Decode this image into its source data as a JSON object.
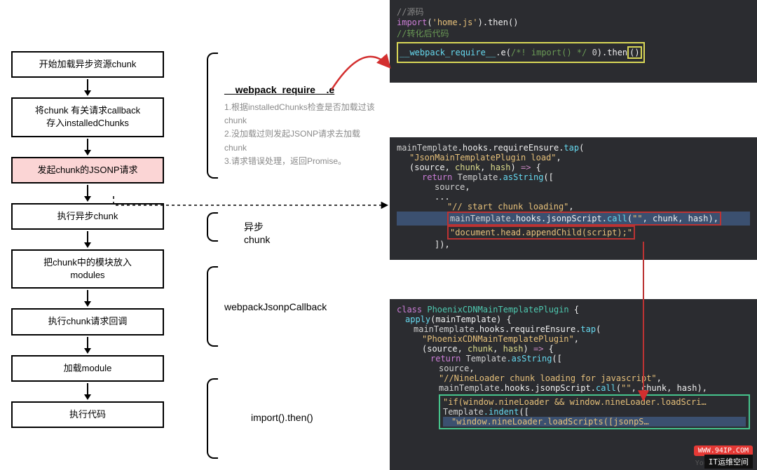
{
  "flowchart": {
    "steps": [
      "开始加载异步资源chunk",
      "将chunk 有关请求callback\n存入installedChunks",
      "发起chunk的JSONP请求",
      "执行异步chunk",
      "把chunk中的模块放入\nmodules",
      "执行chunk请求回调",
      "加载module",
      "执行代码"
    ]
  },
  "braces": {
    "b1": {
      "title": "__webpack_require__.e",
      "desc1": "1.根据installedChunks检查是否加载过该chunk",
      "desc2": "2.没加载过则发起JSONP请求去加载chunk",
      "desc3": "3.请求错误处理，返回Promise。"
    },
    "b2": {
      "title": "异步 chunk"
    },
    "b3": {
      "title": "webpackJsonpCallback"
    },
    "b4": {
      "title": "import().then()"
    }
  },
  "code1": {
    "l1_cm": "//源码",
    "l2_kw": "import",
    "l2_p": "(",
    "l2_str": "'home.js'",
    "l2_p2": ").then()",
    "l3_cm": "//转化后代码",
    "l4_a": "__webpack_require__",
    "l4_b": ".e(",
    "l4_cm": "/*! import() */",
    "l4_c": " 0",
    "l4_d": ").then",
    "l4_e": "()"
  },
  "code2": {
    "l1_a": "mainTemplate",
    "l1_b": ".hooks.requireEnsure.",
    "l1_c": "tap",
    "l1_d": "(",
    "l2_a": "\"JsonMainTemplatePlugin load\"",
    "l2_b": ",",
    "l3_a": "(source",
    "l3_b": ", ",
    "l3_c": "chunk",
    "l3_d": ", ",
    "l3_e": "hash",
    "l3_f": ") ",
    "l3_ar": "=>",
    "l3_g": " {",
    "l4_a": "return",
    "l4_b": " Template",
    "l4_c": ".asString",
    "l4_d": "([",
    "l5_a": "source",
    "l5_b": ",",
    "l6_a": "...",
    "l6_b": "",
    "l7_a": "\"// start chunk loading\"",
    "l7_b": ",",
    "l8_a": "mainTemplate",
    "l8_b": ".hooks.jsonpScript.",
    "l8_c": "call",
    "l8_d": "(",
    "l8_e": "\"\"",
    "l8_f": ", chunk, hash),",
    "l9_a": "\"document.head.appendChild(script);\"",
    "l10_a": "]),"
  },
  "code3": {
    "l1_a": "class",
    "l1_b": " PhoenixCDNMainTemplatePlugin ",
    "l1_c": "{",
    "l2_a": "apply",
    "l2_b": "(mainTemplate) {",
    "l3_a": "mainTemplate",
    "l3_b": ".hooks.requireEnsure.",
    "l3_c": "tap",
    "l3_d": "(",
    "l4_a": "\"PhoenixCDNMainTemplatePlugin\"",
    "l4_b": ",",
    "l5_a": "(source",
    "l5_b": ", ",
    "l5_c": "chunk",
    "l5_d": ", ",
    "l5_e": "hash",
    "l5_f": ") ",
    "l5_ar": "=>",
    "l5_g": " {",
    "l6_a": "return",
    "l6_b": " Template",
    "l6_c": ".asString",
    "l6_d": "([",
    "l7_a": "source",
    "l7_b": ",",
    "l8_a": "\"//NineLoader chunk loading for javascript\"",
    "l8_b": ",",
    "l9_a": "mainTemplate",
    "l9_b": ".hooks.jsonpScript.",
    "l9_c": "call",
    "l9_d": "(",
    "l9_e": "\"\"",
    "l9_f": ", chunk, hash),",
    "l10_a": "\"if(window.nineLoader && window.nineLoader.loadScri…",
    "l11_a": "Template",
    "l11_b": ".indent",
    "l11_c": "([",
    "l12_a": "\"window.nineLoader.loadScripts([jsonpS…",
    "gitlens": "You, 2 years…"
  },
  "badges": {
    "red": "WWW.94IP.COM",
    "dark": "IT运维空间"
  }
}
